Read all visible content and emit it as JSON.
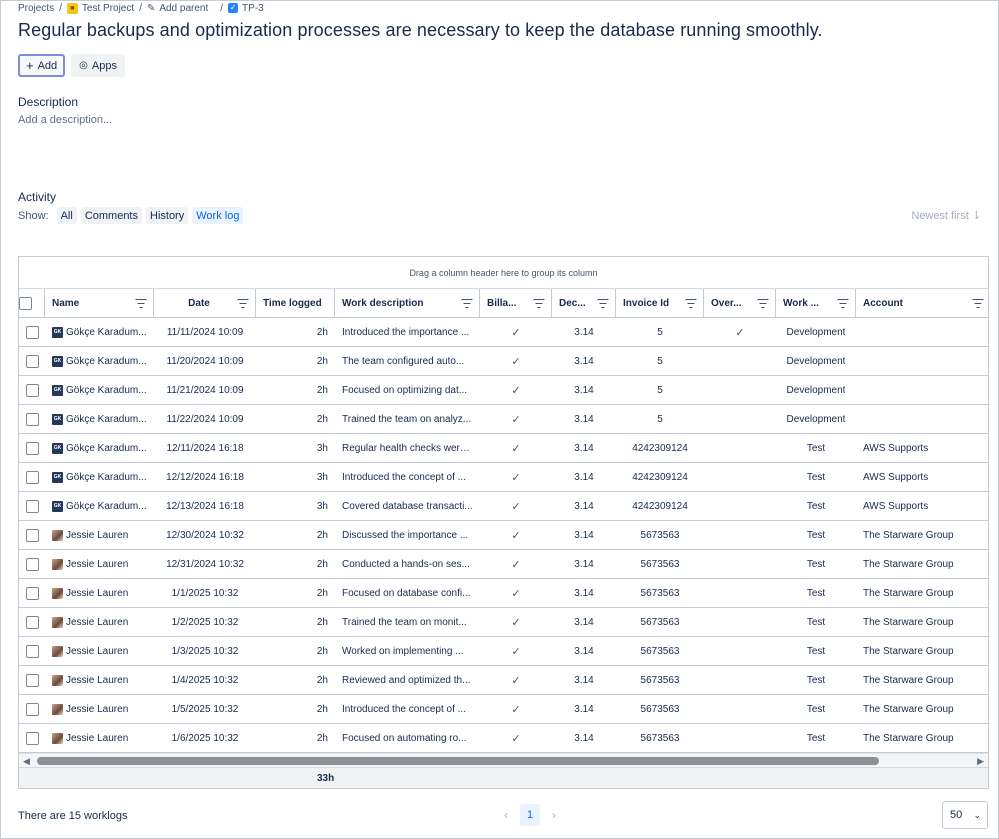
{
  "breadcrumb": {
    "projects": "Projects",
    "project": "Test Project",
    "add_parent": "Add parent",
    "issue_key": "TP-3"
  },
  "title": "Regular backups and optimization processes are necessary to keep the database running smoothly.",
  "buttons": {
    "add": "Add",
    "apps": "Apps"
  },
  "description": {
    "label": "Description",
    "placeholder": "Add a description..."
  },
  "activity": {
    "label": "Activity",
    "show_label": "Show:",
    "filters": [
      "All",
      "Comments",
      "History",
      "Work log"
    ],
    "active_filter": "Work log",
    "sort": "Newest first"
  },
  "grid": {
    "group_hint": "Drag a column header here to group its column",
    "columns": [
      "Name",
      "Date",
      "Time logged",
      "Work description",
      "Billa...",
      "Dec...",
      "Invoice Id",
      "Over...",
      "Work ...",
      "Account"
    ],
    "rows": [
      {
        "name": "Gökçe Karadum...",
        "avatar": "dark",
        "date": "11/11/2024 10:09",
        "time": "2h",
        "desc": "Introduced the importance ...",
        "billable": "✓",
        "dec": "3.14",
        "invoice": "5",
        "over": "✓",
        "work": "Development",
        "account": ""
      },
      {
        "name": "Gökçe Karadum...",
        "avatar": "dark",
        "date": "11/20/2024 10:09",
        "time": "2h",
        "desc": "The team configured auto...",
        "billable": "✓",
        "dec": "3.14",
        "invoice": "5",
        "over": "",
        "work": "Development",
        "account": ""
      },
      {
        "name": "Gökçe Karadum...",
        "avatar": "dark",
        "date": "11/21/2024 10:09",
        "time": "2h",
        "desc": "Focused on optimizing dat...",
        "billable": "✓",
        "dec": "3.14",
        "invoice": "5",
        "over": "",
        "work": "Development",
        "account": ""
      },
      {
        "name": "Gökçe Karadum...",
        "avatar": "dark",
        "date": "11/22/2024 10:09",
        "time": "2h",
        "desc": "Trained the team on analyz...",
        "billable": "✓",
        "dec": "3.14",
        "invoice": "5",
        "over": "",
        "work": "Development",
        "account": ""
      },
      {
        "name": "Gökçe Karadum...",
        "avatar": "dark",
        "date": "12/11/2024 16:18",
        "time": "3h",
        "desc": "Regular health checks were...",
        "billable": "✓",
        "dec": "3.14",
        "invoice": "4242309124",
        "over": "",
        "work": "Test",
        "account": "AWS Supports"
      },
      {
        "name": "Gökçe Karadum...",
        "avatar": "dark",
        "date": "12/12/2024 16:18",
        "time": "3h",
        "desc": "Introduced the concept of ...",
        "billable": "✓",
        "dec": "3.14",
        "invoice": "4242309124",
        "over": "",
        "work": "Test",
        "account": "AWS Supports"
      },
      {
        "name": "Gökçe Karadum...",
        "avatar": "dark",
        "date": "12/13/2024 16:18",
        "time": "3h",
        "desc": "Covered database transacti...",
        "billable": "✓",
        "dec": "3.14",
        "invoice": "4242309124",
        "over": "",
        "work": "Test",
        "account": "AWS Supports"
      },
      {
        "name": "Jessie Lauren",
        "avatar": "photo",
        "date": "12/30/2024 10:32",
        "time": "2h",
        "desc": "Discussed the importance ...",
        "billable": "✓",
        "dec": "3.14",
        "invoice": "5673563",
        "over": "",
        "work": "Test",
        "account": "The Starware Group"
      },
      {
        "name": "Jessie Lauren",
        "avatar": "photo",
        "date": "12/31/2024 10:32",
        "time": "2h",
        "desc": "Conducted a hands-on ses...",
        "billable": "✓",
        "dec": "3.14",
        "invoice": "5673563",
        "over": "",
        "work": "Test",
        "account": "The Starware Group"
      },
      {
        "name": "Jessie Lauren",
        "avatar": "photo",
        "date": "1/1/2025 10:32",
        "time": "2h",
        "desc": "Focused on database confi...",
        "billable": "✓",
        "dec": "3.14",
        "invoice": "5673563",
        "over": "",
        "work": "Test",
        "account": "The Starware Group"
      },
      {
        "name": "Jessie Lauren",
        "avatar": "photo",
        "date": "1/2/2025 10:32",
        "time": "2h",
        "desc": "Trained the team on monit...",
        "billable": "✓",
        "dec": "3.14",
        "invoice": "5673563",
        "over": "",
        "work": "Test",
        "account": "The Starware Group"
      },
      {
        "name": "Jessie Lauren",
        "avatar": "photo",
        "date": "1/3/2025 10:32",
        "time": "2h",
        "desc": "Worked on implementing ...",
        "billable": "✓",
        "dec": "3.14",
        "invoice": "5673563",
        "over": "",
        "work": "Test",
        "account": "The Starware Group"
      },
      {
        "name": "Jessie Lauren",
        "avatar": "photo",
        "date": "1/4/2025 10:32",
        "time": "2h",
        "desc": "Reviewed and optimized th...",
        "billable": "✓",
        "dec": "3.14",
        "invoice": "5673563",
        "over": "",
        "work": "Test",
        "account": "The Starware Group"
      },
      {
        "name": "Jessie Lauren",
        "avatar": "photo",
        "date": "1/5/2025 10:32",
        "time": "2h",
        "desc": "Introduced the concept of ...",
        "billable": "✓",
        "dec": "3.14",
        "invoice": "5673563",
        "over": "",
        "work": "Test",
        "account": "The Starware Group"
      },
      {
        "name": "Jessie Lauren",
        "avatar": "photo",
        "date": "1/6/2025 10:32",
        "time": "2h",
        "desc": "Focused on automating ro...",
        "billable": "✓",
        "dec": "3.14",
        "invoice": "5673563",
        "over": "",
        "work": "Test",
        "account": "The Starware Group"
      }
    ],
    "total_time": "33h"
  },
  "footer": {
    "count_text": "There are 15 worklogs",
    "current_page": "1",
    "page_size": "50"
  },
  "colors": {
    "accent": "#0c66e4",
    "active_chip_bg": "#e9f2ff",
    "text": "#172b4d"
  }
}
